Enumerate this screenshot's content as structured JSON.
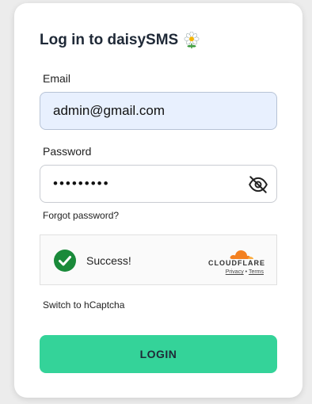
{
  "form": {
    "title": "Log in to daisySMS",
    "title_icon": "daisy-flower-icon",
    "email_label": "Email",
    "email_value": "admin@gmail.com",
    "password_label": "Password",
    "password_value": "•••••••••",
    "password_toggle_icon": "eye-off-icon",
    "forgot_link": "Forgot password?",
    "switch_link": "Switch to hCaptcha",
    "login_button": "LOGIN"
  },
  "captcha": {
    "status_icon": "success-check-icon",
    "status_text": "Success!",
    "provider": "CLOUDFLARE",
    "privacy_link": "Privacy",
    "separator": "•",
    "terms_link": "Terms"
  },
  "colors": {
    "accent": "#34d399",
    "email_bg": "#e8f0fe",
    "check_green": "#1a8a3a",
    "cloudflare_orange": "#f38020"
  }
}
